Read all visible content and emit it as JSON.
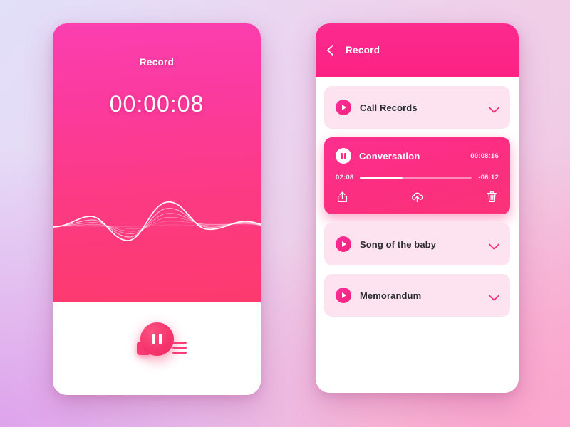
{
  "theme": {
    "accent_pink": "#fb2e80",
    "accent_magenta": "#fd2a8f",
    "accent_rose": "#f5336b",
    "card_light": "#fde3ef",
    "bg_top_left": "#e2dff9",
    "bg_top_right": "#f0cee8",
    "bg_bottom_left": "#dda0eb",
    "bg_bottom_right": "#fba5cd"
  },
  "record_screen": {
    "title": "Record",
    "timer": "00:00:08",
    "waveform_icon": "audio-waveform",
    "controls": {
      "stop_label": "stop-button",
      "pause_label": "pause-button",
      "list_label": "list-button"
    }
  },
  "list_screen": {
    "header": {
      "back_icon": "chevron-left-icon",
      "title": "Record"
    },
    "items": [
      {
        "label": "Call Records",
        "state": "collapsed",
        "play_icon": "play-icon",
        "chevron_icon": "chevron-down-icon"
      },
      {
        "label": "Conversation",
        "state": "expanded",
        "pause_icon": "pause-icon",
        "duration": "00:08:16",
        "elapsed": "02:08",
        "remaining": "-06:12",
        "progress_percent": 38,
        "actions": [
          {
            "name": "share-icon",
            "label": "Share"
          },
          {
            "name": "cloud-upload-icon",
            "label": "Upload"
          },
          {
            "name": "trash-icon",
            "label": "Delete"
          }
        ]
      },
      {
        "label": "Song of the baby",
        "state": "collapsed",
        "play_icon": "play-icon",
        "chevron_icon": "chevron-down-icon"
      },
      {
        "label": "Memorandum",
        "state": "collapsed",
        "play_icon": "play-icon",
        "chevron_icon": "chevron-down-icon"
      }
    ]
  }
}
